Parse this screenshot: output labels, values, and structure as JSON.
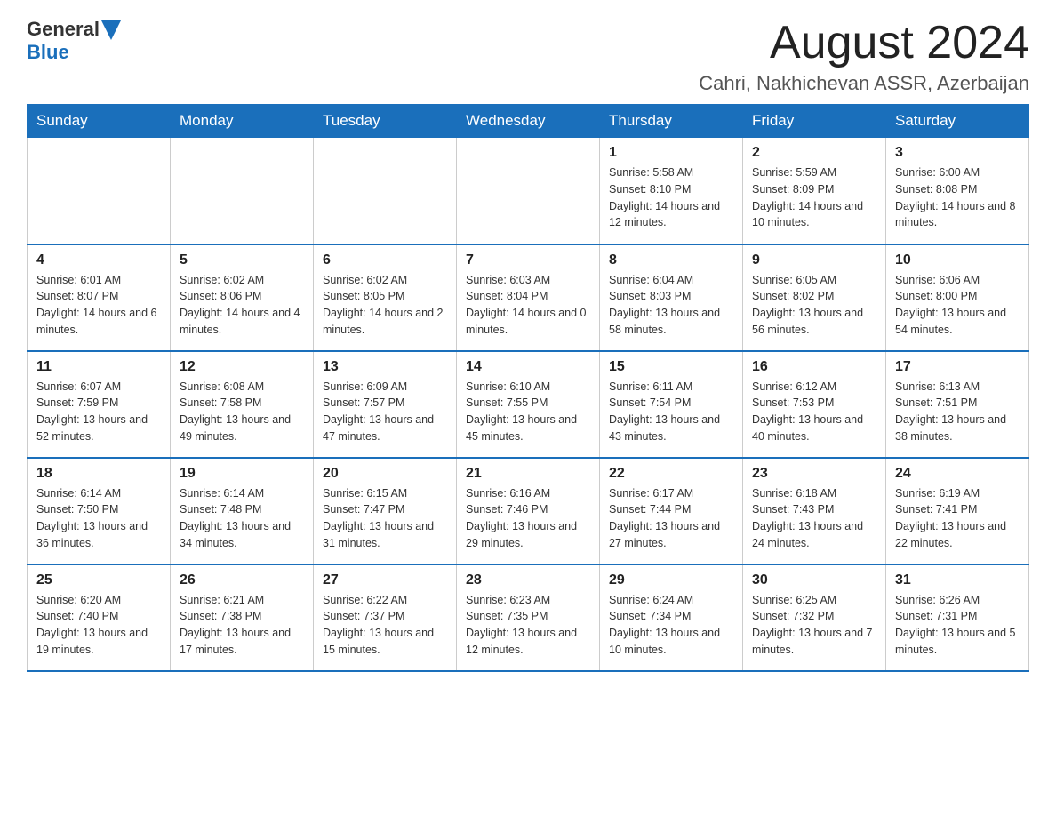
{
  "header": {
    "logo_general": "General",
    "logo_blue": "Blue",
    "month_title": "August 2024",
    "location": "Cahri, Nakhichevan ASSR, Azerbaijan"
  },
  "days_of_week": [
    "Sunday",
    "Monday",
    "Tuesday",
    "Wednesday",
    "Thursday",
    "Friday",
    "Saturday"
  ],
  "weeks": [
    [
      {
        "day": "",
        "info": ""
      },
      {
        "day": "",
        "info": ""
      },
      {
        "day": "",
        "info": ""
      },
      {
        "day": "",
        "info": ""
      },
      {
        "day": "1",
        "info": "Sunrise: 5:58 AM\nSunset: 8:10 PM\nDaylight: 14 hours and 12 minutes."
      },
      {
        "day": "2",
        "info": "Sunrise: 5:59 AM\nSunset: 8:09 PM\nDaylight: 14 hours and 10 minutes."
      },
      {
        "day": "3",
        "info": "Sunrise: 6:00 AM\nSunset: 8:08 PM\nDaylight: 14 hours and 8 minutes."
      }
    ],
    [
      {
        "day": "4",
        "info": "Sunrise: 6:01 AM\nSunset: 8:07 PM\nDaylight: 14 hours and 6 minutes."
      },
      {
        "day": "5",
        "info": "Sunrise: 6:02 AM\nSunset: 8:06 PM\nDaylight: 14 hours and 4 minutes."
      },
      {
        "day": "6",
        "info": "Sunrise: 6:02 AM\nSunset: 8:05 PM\nDaylight: 14 hours and 2 minutes."
      },
      {
        "day": "7",
        "info": "Sunrise: 6:03 AM\nSunset: 8:04 PM\nDaylight: 14 hours and 0 minutes."
      },
      {
        "day": "8",
        "info": "Sunrise: 6:04 AM\nSunset: 8:03 PM\nDaylight: 13 hours and 58 minutes."
      },
      {
        "day": "9",
        "info": "Sunrise: 6:05 AM\nSunset: 8:02 PM\nDaylight: 13 hours and 56 minutes."
      },
      {
        "day": "10",
        "info": "Sunrise: 6:06 AM\nSunset: 8:00 PM\nDaylight: 13 hours and 54 minutes."
      }
    ],
    [
      {
        "day": "11",
        "info": "Sunrise: 6:07 AM\nSunset: 7:59 PM\nDaylight: 13 hours and 52 minutes."
      },
      {
        "day": "12",
        "info": "Sunrise: 6:08 AM\nSunset: 7:58 PM\nDaylight: 13 hours and 49 minutes."
      },
      {
        "day": "13",
        "info": "Sunrise: 6:09 AM\nSunset: 7:57 PM\nDaylight: 13 hours and 47 minutes."
      },
      {
        "day": "14",
        "info": "Sunrise: 6:10 AM\nSunset: 7:55 PM\nDaylight: 13 hours and 45 minutes."
      },
      {
        "day": "15",
        "info": "Sunrise: 6:11 AM\nSunset: 7:54 PM\nDaylight: 13 hours and 43 minutes."
      },
      {
        "day": "16",
        "info": "Sunrise: 6:12 AM\nSunset: 7:53 PM\nDaylight: 13 hours and 40 minutes."
      },
      {
        "day": "17",
        "info": "Sunrise: 6:13 AM\nSunset: 7:51 PM\nDaylight: 13 hours and 38 minutes."
      }
    ],
    [
      {
        "day": "18",
        "info": "Sunrise: 6:14 AM\nSunset: 7:50 PM\nDaylight: 13 hours and 36 minutes."
      },
      {
        "day": "19",
        "info": "Sunrise: 6:14 AM\nSunset: 7:48 PM\nDaylight: 13 hours and 34 minutes."
      },
      {
        "day": "20",
        "info": "Sunrise: 6:15 AM\nSunset: 7:47 PM\nDaylight: 13 hours and 31 minutes."
      },
      {
        "day": "21",
        "info": "Sunrise: 6:16 AM\nSunset: 7:46 PM\nDaylight: 13 hours and 29 minutes."
      },
      {
        "day": "22",
        "info": "Sunrise: 6:17 AM\nSunset: 7:44 PM\nDaylight: 13 hours and 27 minutes."
      },
      {
        "day": "23",
        "info": "Sunrise: 6:18 AM\nSunset: 7:43 PM\nDaylight: 13 hours and 24 minutes."
      },
      {
        "day": "24",
        "info": "Sunrise: 6:19 AM\nSunset: 7:41 PM\nDaylight: 13 hours and 22 minutes."
      }
    ],
    [
      {
        "day": "25",
        "info": "Sunrise: 6:20 AM\nSunset: 7:40 PM\nDaylight: 13 hours and 19 minutes."
      },
      {
        "day": "26",
        "info": "Sunrise: 6:21 AM\nSunset: 7:38 PM\nDaylight: 13 hours and 17 minutes."
      },
      {
        "day": "27",
        "info": "Sunrise: 6:22 AM\nSunset: 7:37 PM\nDaylight: 13 hours and 15 minutes."
      },
      {
        "day": "28",
        "info": "Sunrise: 6:23 AM\nSunset: 7:35 PM\nDaylight: 13 hours and 12 minutes."
      },
      {
        "day": "29",
        "info": "Sunrise: 6:24 AM\nSunset: 7:34 PM\nDaylight: 13 hours and 10 minutes."
      },
      {
        "day": "30",
        "info": "Sunrise: 6:25 AM\nSunset: 7:32 PM\nDaylight: 13 hours and 7 minutes."
      },
      {
        "day": "31",
        "info": "Sunrise: 6:26 AM\nSunset: 7:31 PM\nDaylight: 13 hours and 5 minutes."
      }
    ]
  ]
}
